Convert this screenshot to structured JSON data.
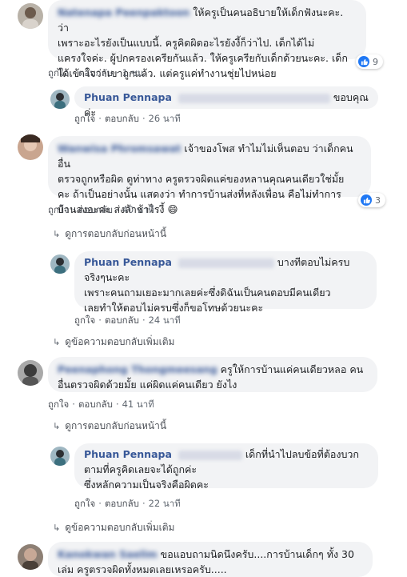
{
  "comments": [
    {
      "author": "Natenapa Peenpaktoon",
      "text": "ให้ครูเป็นคนอธิบายให้เด็กฟังนะคะ. ว่า เพราะอะไรยังเป็นแบบนี้. ครูคิดผิดอะไรยังงี้ก็ว่าไป. เด็กได้ไม่ แครงใจค่ะ. ผู้ปกครองเครียกันแล้ว. ให้ครูเครียกับเด็กด้วยนะคะ. เด็ก ได้เข้าใจว่าเขาถูกแล้ว. แต่ครูแค่ทำงานชุ่ยไปหน่อย",
      "lines": [
        "ให้ครูเป็นคนอธิบายให้เด็กฟังนะคะ. ว่า",
        "เพราะอะไรยังเป็นแบบนี้. ครูคิดผิดอะไรยังงี้ก็ว่าไป. เด็กได้ไม่",
        "แครงใจค่ะ. ผู้ปกครองเครียกันแล้ว. ให้ครูเครียกับเด็กด้วยนะคะ. เด็ก",
        "ได้เข้าใจว่าเขาถูกแล้ว. แต่ครูแค่ทำงานชุ่ยไปหน่อย"
      ],
      "like_label": "ถูกใจ",
      "reply_label": "ตอบกลับ",
      "time": "1 ชม.",
      "reaction_count": "9",
      "reply": {
        "author": "Phuan Pennapa",
        "text": "ขอบคุณค่ะ",
        "like_label": "ถูกใจ",
        "reply_label": "ตอบกลับ",
        "time": "26 นาที"
      }
    },
    {
      "author": "Wanwisa Phromsawat",
      "lines": [
        "เจ้าของโพส ทำไมไม่เห็นตอบ ว่าเด็กคนอื่น",
        "ตรวจถูกหรือผิด ดูท่าทาง ครูตรวจผิดแค่ของหลานคุณคนเดียวใช่มั้ย",
        "คะ ถ้าเป็นอย่างนั้น แสดงว่า ทำการบ้านส่งที่หลังเพื่อน คือไม่ทำการ",
        "บ้านส่งอะค่ะ ส่งล้าช้าไรงี้ 😄"
      ],
      "like_label": "ถูกใจ",
      "reply_label": "ตอบกลับ",
      "time": "40 นาที",
      "reaction_count": "3",
      "view_previous": "ดูการตอบกลับก่อนหน้านี้",
      "reply": {
        "author": "Phuan Pennapa",
        "lines": [
          "บางทีตอบไม่ครบ",
          "จริงๆนะคะ",
          "เพราะคนถามเยอะมากเลยค่ะซึ่งดิฉันเป็นคนตอบมีคนเดียว",
          "เลยทำให้ตอบไม่ครบซึ่งก็ขอโทษด้วยนะคะ"
        ],
        "like_label": "ถูกใจ",
        "reply_label": "ตอบกลับ",
        "time": "24 นาที"
      },
      "view_more": "ดูข้อความตอบกลับเพิ่มเติม"
    },
    {
      "author": "Peenaphong Thongmeesang",
      "lines": [
        "ครูให้การบ้านแค่คนเดียวหลอ คน",
        "อื่นตรวจผิดด้วยมั้ย แค่ผิดแค่คนเดียว ยังไง"
      ],
      "like_label": "ถูกใจ",
      "reply_label": "ตอบกลับ",
      "time": "41 นาที",
      "view_previous": "ดูการตอบกลับก่อนหน้านี้",
      "reply": {
        "author": "Phuan Pennapa",
        "lines": [
          "เด็กที่นำไปลบข้อที่ต้องบวก",
          "ตามที่ครูคิดเลยจะได้ถูกค่ะ",
          "ซึ่งหลักความเป็นจริงคือผิดคะ"
        ],
        "like_label": "ถูกใจ",
        "reply_label": "ตอบกลับ",
        "time": "22 นาที"
      },
      "view_more": "ดูข้อความตอบกลับเพิ่มเติม"
    },
    {
      "author": "Kanokwan Saelim",
      "lines": [
        "ขอแอบถามนิดนึงครับ....การบ้านเด็กๆ ทั้ง 30",
        "เล่ม ครูตรวจผิดทั้งหมดเลยเหรอครับ....."
      ]
    }
  ],
  "colors": {
    "name": "#385898",
    "bubble": "#f2f3f5",
    "like": "#2078f4",
    "meta": "#606770"
  }
}
